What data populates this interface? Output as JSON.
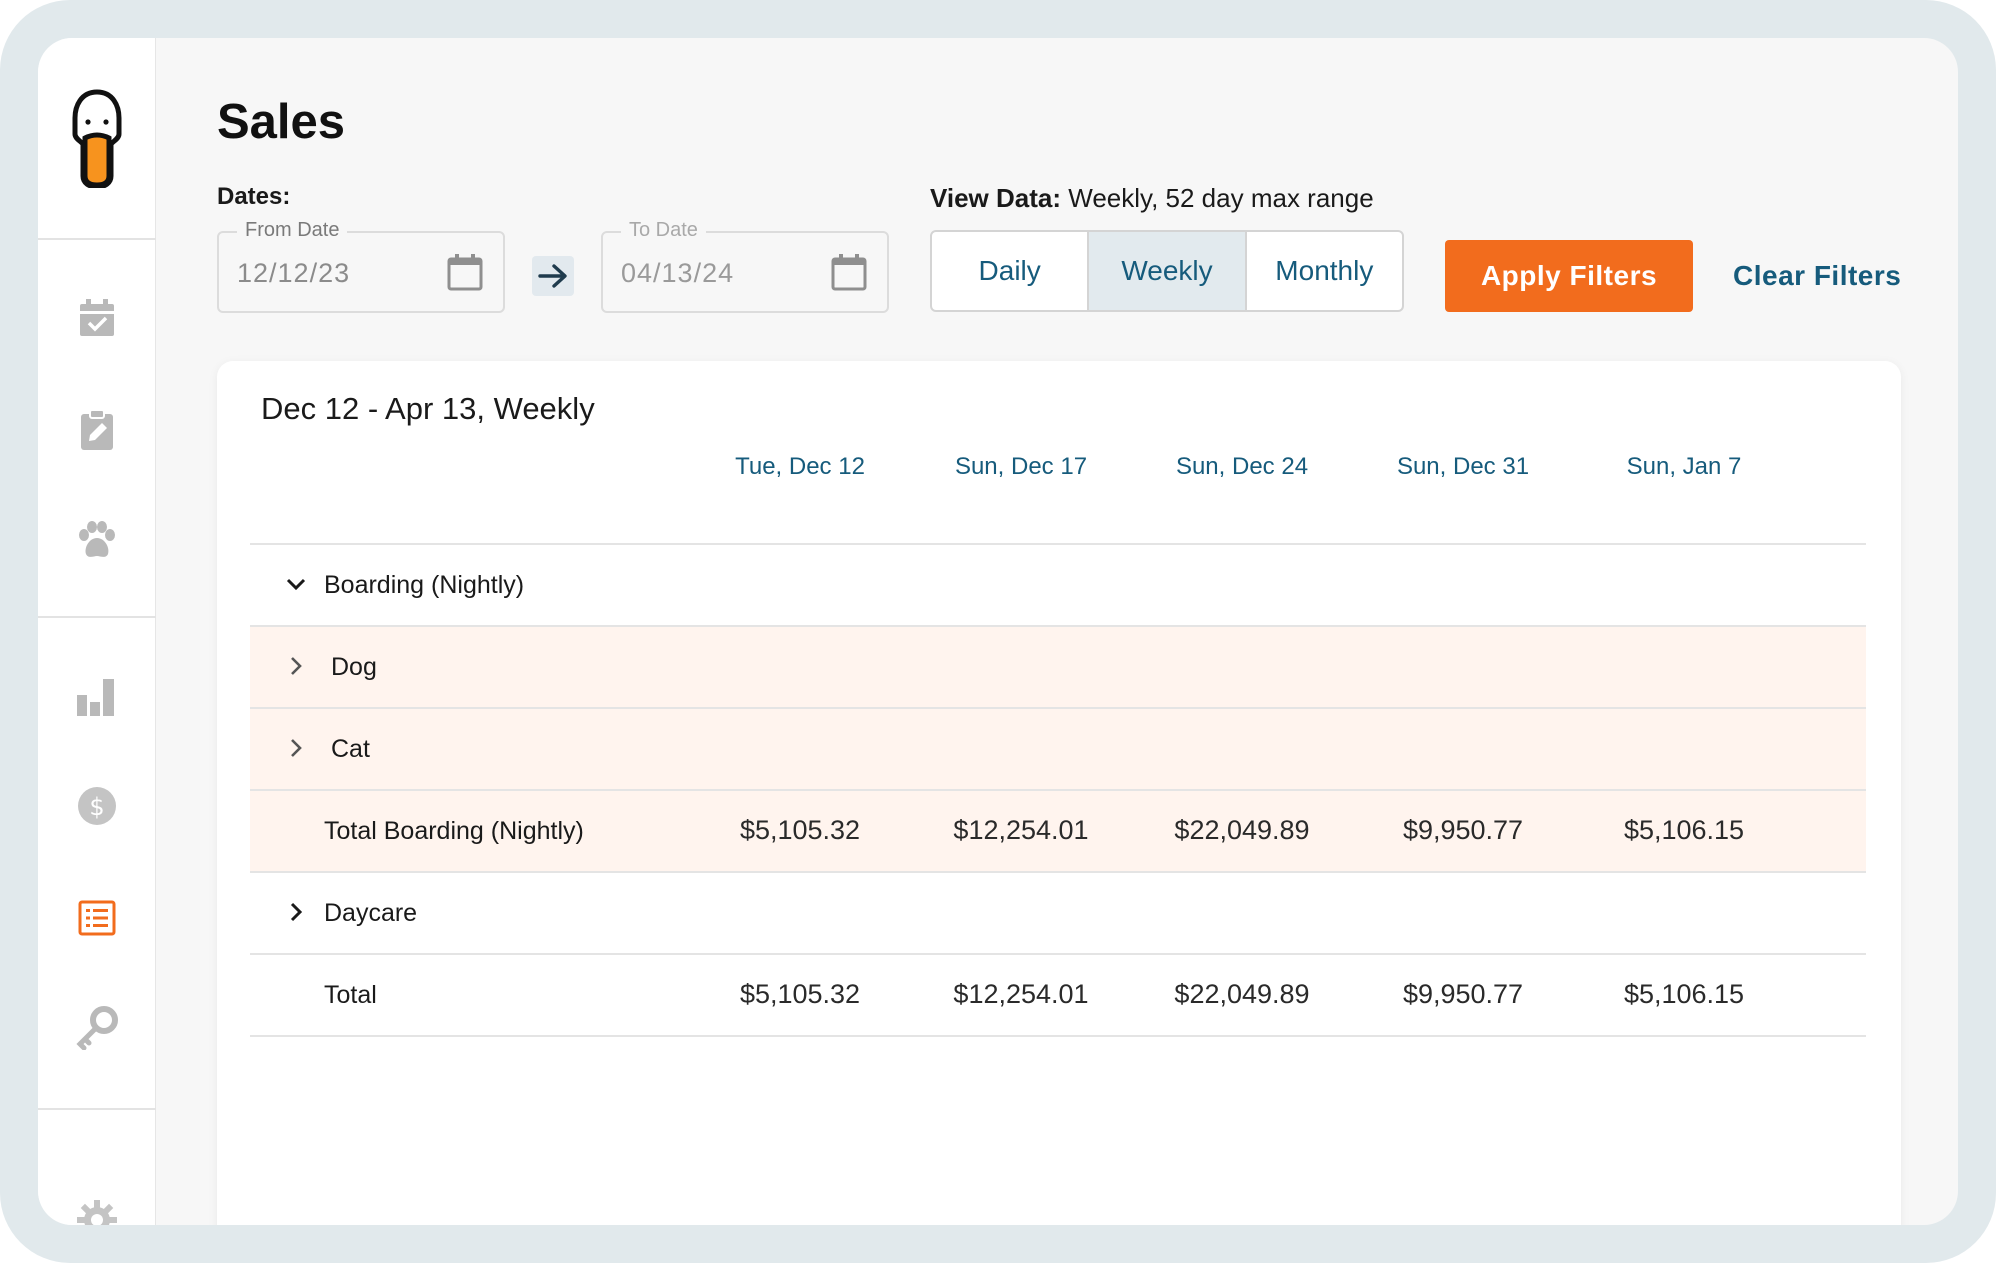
{
  "page": {
    "title": "Sales"
  },
  "filters": {
    "dates_label": "Dates:",
    "from": {
      "legend": "From Date",
      "value": "12/12/23"
    },
    "to": {
      "legend": "To Date",
      "value": "04/13/24"
    },
    "view_data_label": "View Data:",
    "view_data_value": "Weekly, 52 day max range",
    "periods": [
      "Daily",
      "Weekly",
      "Monthly"
    ],
    "active_period": "Weekly",
    "apply_label": "Apply Filters",
    "clear_label": "Clear Filters"
  },
  "report": {
    "title": "Dec 12 - Apr 13, Weekly",
    "columns": [
      "Tue, Dec 12",
      "Sun, Dec 17",
      "Sun, Dec 24",
      "Sun, Dec 31",
      "Sun, Jan 7"
    ],
    "rows": [
      {
        "label": "Boarding (Nightly)",
        "expanded": true,
        "values": []
      },
      {
        "label": "Dog",
        "expanded": false,
        "values": []
      },
      {
        "label": "Cat",
        "expanded": false,
        "values": []
      },
      {
        "label": "Total Boarding (Nightly)",
        "values": [
          "$5,105.32",
          "$12,254.01",
          "$22,049.89",
          "$9,950.77",
          "$5,106.15"
        ]
      },
      {
        "label": "Daycare",
        "expanded": false,
        "values": []
      },
      {
        "label": "Total",
        "values": [
          "$5,105.32",
          "$12,254.01",
          "$22,049.89",
          "$9,950.77",
          "$5,106.15"
        ]
      }
    ]
  },
  "sidebar": {
    "items": [
      {
        "icon": "calendar-check-icon"
      },
      {
        "icon": "clipboard-edit-icon"
      },
      {
        "icon": "paw-icon"
      },
      {
        "icon": "bar-chart-icon"
      },
      {
        "icon": "dollar-icon"
      },
      {
        "icon": "list-report-icon",
        "active": true
      },
      {
        "icon": "key-icon"
      },
      {
        "icon": "gear-icon"
      }
    ]
  },
  "colors": {
    "accent": "#f26c1d",
    "link": "#165b7c",
    "active_segment": "#e2eaee",
    "row_tint": "#fff4ee"
  }
}
